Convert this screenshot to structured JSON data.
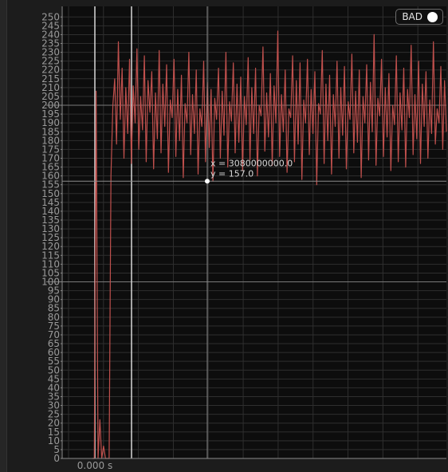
{
  "chart_data": {
    "type": "line",
    "title": "",
    "xlabel": "",
    "ylabel": "",
    "ylim": [
      0,
      256
    ],
    "y_ticks": [
      0,
      5,
      10,
      15,
      20,
      25,
      30,
      35,
      40,
      45,
      50,
      55,
      60,
      65,
      70,
      75,
      80,
      85,
      90,
      95,
      100,
      105,
      110,
      115,
      120,
      125,
      130,
      135,
      140,
      145,
      150,
      155,
      160,
      165,
      170,
      175,
      180,
      185,
      190,
      195,
      200,
      205,
      210,
      215,
      220,
      225,
      230,
      235,
      240,
      245,
      250
    ],
    "y_tick_labels": [
      "0",
      "5",
      "10",
      "15",
      "20",
      "25",
      "30",
      "35",
      "40",
      "45",
      "50",
      "55",
      "60",
      "65",
      "70",
      "75",
      "80",
      "85",
      "90",
      "95",
      "100",
      "105",
      "110",
      "115",
      "120",
      "125",
      "130",
      "135",
      "140",
      "145",
      "150",
      "155",
      "160",
      "165",
      "170",
      "175",
      "180",
      "185",
      "190",
      "195",
      "200",
      "205",
      "210",
      "215",
      "220",
      "225",
      "230",
      "235",
      "240",
      "245",
      "250"
    ],
    "x_tick_label": "0.000 s",
    "grid": true,
    "reference_lines_y": [
      100,
      200
    ],
    "series": [
      {
        "color": "#c0504d",
        "values": [
          0,
          0,
          208,
          0,
          22,
          0,
          7,
          0,
          0,
          0,
          160,
          200,
          215,
          178,
          236,
          192,
          221,
          170,
          210,
          184,
          226,
          167,
          211,
          190,
          232,
          175,
          205,
          186,
          228,
          168,
          214,
          196,
          219,
          164,
          207,
          181,
          231,
          173,
          212,
          188,
          223,
          162,
          203,
          193,
          226,
          171,
          209,
          180,
          217,
          159,
          201,
          190,
          230,
          172,
          206,
          184,
          220,
          161,
          198,
          188,
          225,
          168,
          213,
          176,
          209,
          157,
          204,
          192,
          221,
          170,
          208,
          183,
          230,
          165,
          202,
          191,
          224,
          173,
          212,
          179,
          216,
          163,
          205,
          189,
          227,
          169,
          210,
          184,
          221,
          160,
          200,
          194,
          233,
          174,
          207,
          182,
          218,
          166,
          211,
          190,
          242,
          171,
          206,
          185,
          220,
          162,
          198,
          193,
          228,
          168,
          214,
          178,
          224,
          158,
          203,
          190,
          226,
          172,
          209,
          184,
          219,
          155,
          201,
          195,
          231,
          167,
          212,
          180,
          217,
          161,
          206,
          188,
          225,
          170,
          210,
          183,
          222,
          164,
          202,
          192,
          229,
          173,
          208,
          179,
          220,
          159,
          205,
          190,
          223,
          169,
          213,
          185,
          240,
          166,
          204,
          194,
          226,
          171,
          210,
          182,
          218,
          163,
          200,
          189,
          228,
          168,
          207,
          186,
          221,
          165,
          209,
          193,
          234,
          172,
          206,
          181,
          225,
          167,
          212,
          188,
          219,
          170,
          203,
          184,
          236,
          178,
          198,
          190,
          222,
          175,
          214,
          185
        ],
        "x_range_note": "uniform samples across plot width"
      }
    ],
    "cursor": {
      "x": 3080000000.0,
      "y": 157.0
    },
    "vertical_markers": 2
  },
  "readout": {
    "x_text": "x = 3080000000.0",
    "y_text": "y = 157.0"
  },
  "badge": {
    "label": "BAD"
  },
  "colors": {
    "plot_bg": "#0d0d0d",
    "grid": "#2f2f2f",
    "reference": "#7a7a7a",
    "series": "#c0504d",
    "marker": "#d8d8d8"
  }
}
